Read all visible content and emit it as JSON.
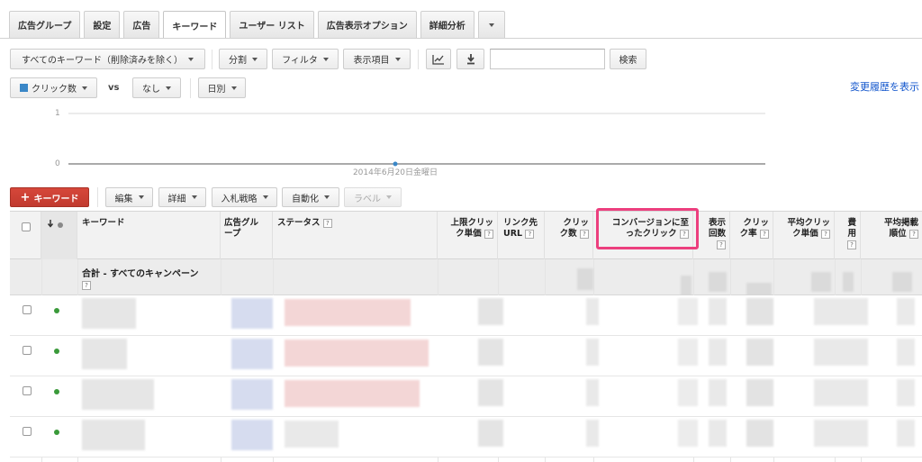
{
  "tabs": [
    {
      "label": "広告グループ"
    },
    {
      "label": "設定"
    },
    {
      "label": "広告"
    },
    {
      "label": "キーワード"
    },
    {
      "label": "ユーザー リスト"
    },
    {
      "label": "広告表示オプション"
    },
    {
      "label": "詳細分析"
    }
  ],
  "toolbar": {
    "filter_all": "すべてのキーワード（削除済みを除く）",
    "segment": "分割",
    "filter": "フィルタ",
    "columns": "表示項目",
    "search_button": "検索",
    "search_value": ""
  },
  "chart_controls": {
    "metric": "クリック数",
    "vs": "vs",
    "compare": "なし",
    "period": "日別",
    "history_link": "変更履歴を表示"
  },
  "chart_data": {
    "type": "line",
    "x": [
      "2014年6月20日金曜日"
    ],
    "series": [
      {
        "values": [
          0
        ]
      }
    ],
    "ylim": [
      0,
      1
    ],
    "yticks": [
      "1",
      "0"
    ],
    "grid": true
  },
  "actions": {
    "add_keyword": "キーワード",
    "edit": "編集",
    "details": "詳細",
    "bid_strategy": "入札戦略",
    "automate": "自動化",
    "label": "ラベル"
  },
  "table": {
    "headers": {
      "keyword": "キーワード",
      "ad_group_1": "広告グル",
      "ad_group_2": "ープ",
      "status": "ステータス",
      "max_cpc_1": "上限クリッ",
      "max_cpc_2": "ク単価",
      "dest_url_1": "リンク先",
      "dest_url_2": "URL",
      "clicks_1": "クリッ",
      "clicks_2": "ク数",
      "conv_1": "コンバージョンに至",
      "conv_2": "ったクリック",
      "impr_1": "表示",
      "impr_2": "回数",
      "ctr_1": "クリッ",
      "ctr_2": "ク率",
      "avg_cpc_1": "平均クリッ",
      "avg_cpc_2": "ク単価",
      "cost_1": "費",
      "cost_2": "用",
      "avg_pos_1": "平均掲載",
      "avg_pos_2": "順位"
    },
    "help_mark": "?",
    "total_label": "合計 - すべてのキャンペーン",
    "rows": [
      {},
      {},
      {},
      {}
    ]
  },
  "colors": {
    "accent_red": "#c9402f",
    "highlight": "#ec3f7e",
    "link": "#1155cc",
    "enabled_dot": "#3a9a3a",
    "metric_square": "#3a87c7"
  }
}
